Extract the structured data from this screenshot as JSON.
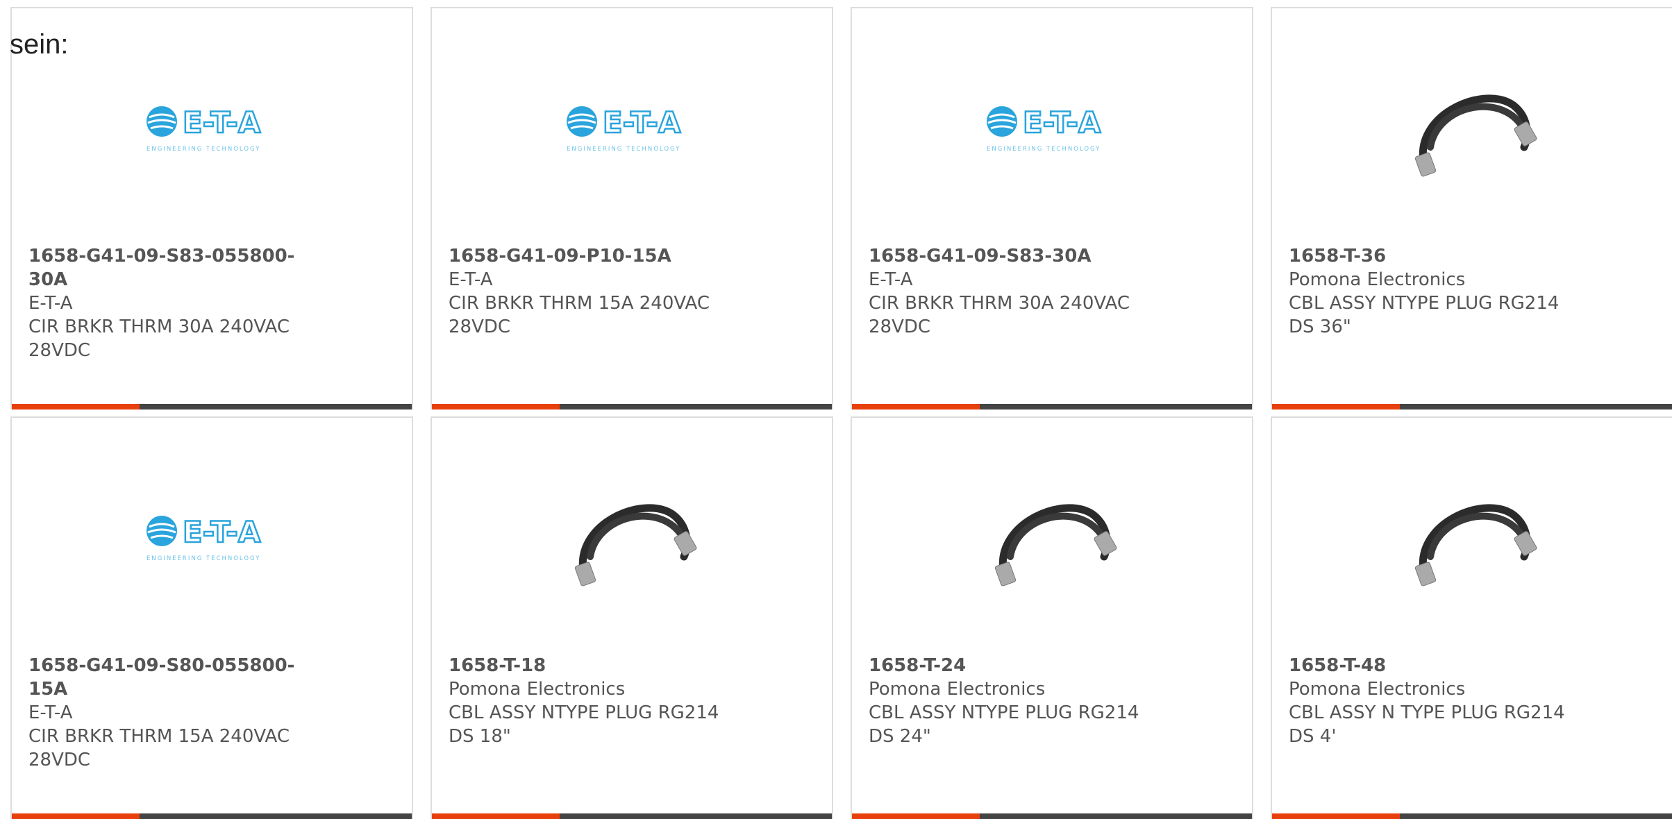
{
  "heading": "sein:",
  "colors": {
    "accent": "#e8400c",
    "bar": "#444444",
    "border": "#dddddd",
    "text": "#555555"
  },
  "products": [
    {
      "part_number": "1658-G41-09-S83-055800-30A",
      "manufacturer": "E-T-A",
      "description": "CIR BRKR THRM 30A 240VAC 28VDC",
      "image": "eta-logo"
    },
    {
      "part_number": "1658-G41-09-P10-15A",
      "manufacturer": "E-T-A",
      "description": "CIR BRKR THRM 15A 240VAC 28VDC",
      "image": "eta-logo"
    },
    {
      "part_number": "1658-G41-09-S83-30A",
      "manufacturer": "E-T-A",
      "description": "CIR BRKR THRM 30A 240VAC 28VDC",
      "image": "eta-logo"
    },
    {
      "part_number": "1658-T-36",
      "manufacturer": "Pomona Electronics",
      "description": "CBL ASSY NTYPE PLUG RG214 DS 36\"",
      "image": "cable-photo"
    },
    {
      "part_number": "1658-G41-09-S80-055800-15A",
      "manufacturer": "E-T-A",
      "description": "CIR BRKR THRM 15A 240VAC 28VDC",
      "image": "eta-logo"
    },
    {
      "part_number": "1658-T-18",
      "manufacturer": "Pomona Electronics",
      "description": "CBL ASSY NTYPE PLUG RG214 DS 18\"",
      "image": "cable-photo"
    },
    {
      "part_number": "1658-T-24",
      "manufacturer": "Pomona Electronics",
      "description": "CBL ASSY NTYPE PLUG RG214 DS 24\"",
      "image": "cable-photo"
    },
    {
      "part_number": "1658-T-48",
      "manufacturer": "Pomona Electronics",
      "description": "CBL ASSY N TYPE PLUG RG214 DS 4'",
      "image": "cable-photo"
    }
  ],
  "eta_logo": {
    "wordmark": "E-T-A",
    "tagline": "ENGINEERING TECHNOLOGY"
  }
}
